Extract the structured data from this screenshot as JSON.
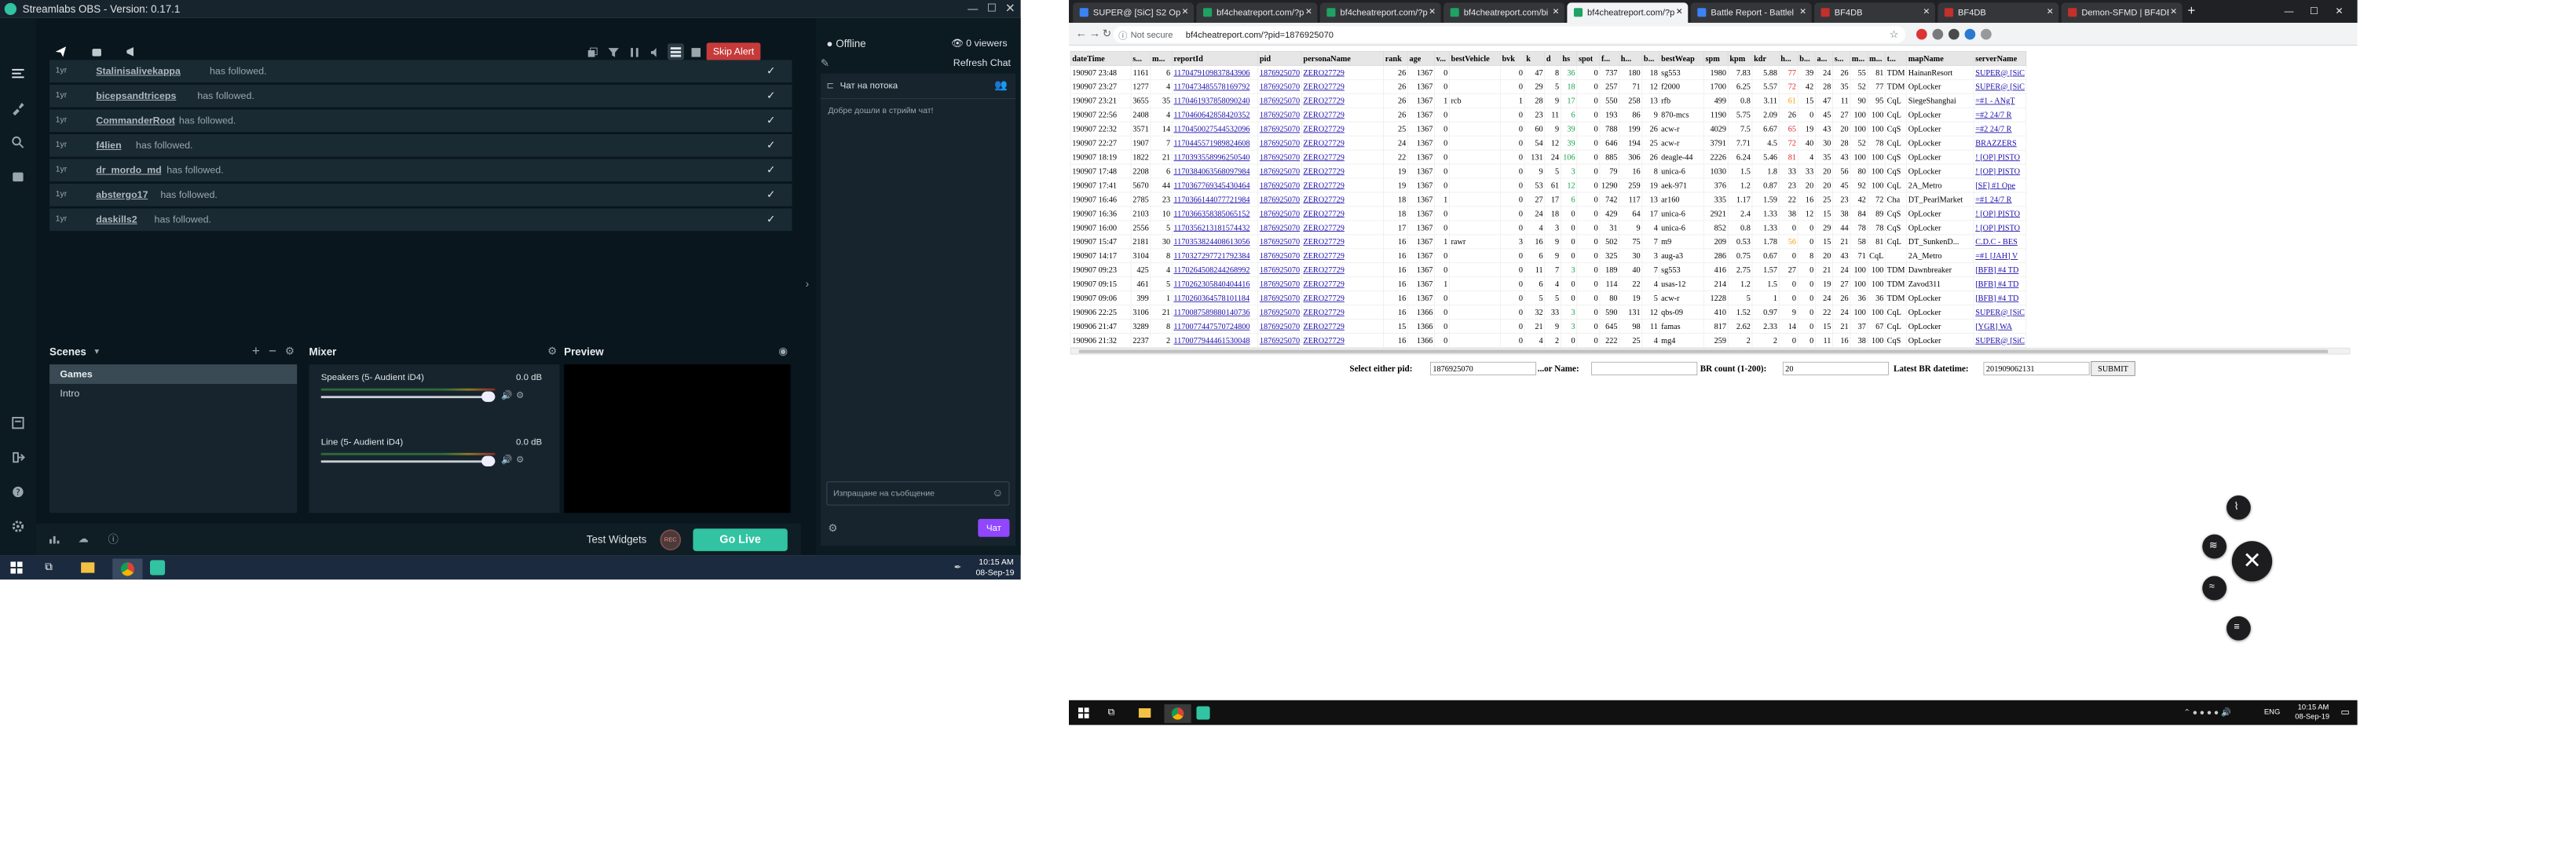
{
  "obs": {
    "title": "Streamlabs OBS - Version: 0.17.1",
    "skip_alert": "Skip Alert",
    "offline": "Offline",
    "viewers": "0 viewers",
    "refresh_chat": "Refresh Chat",
    "chat_title": "Чат на потока",
    "chat_welcome": "Добре дошли в стрийм чат!",
    "chat_placeholder": "Изпращане на съобщение",
    "chat_button": "Чат",
    "events": [
      {
        "time": "1yr",
        "name": "Stalinisalivekappa",
        "action": "has followed."
      },
      {
        "time": "1yr",
        "name": "bicepsandtriceps",
        "action": "has followed."
      },
      {
        "time": "1yr",
        "name": "CommanderRoot",
        "action": "has followed."
      },
      {
        "time": "1yr",
        "name": "f4lien",
        "action": "has followed."
      },
      {
        "time": "1yr",
        "name": "dr_mordo_md",
        "action": "has followed."
      },
      {
        "time": "1yr",
        "name": "abstergo17",
        "action": "has followed."
      },
      {
        "time": "1yr",
        "name": "daskills2",
        "action": "has followed."
      }
    ],
    "scenes_title": "Scenes",
    "scenes": [
      "Games",
      "Intro"
    ],
    "mixer_title": "Mixer",
    "mixer": [
      {
        "name": "Speakers (5- Audient iD4)",
        "db": "0.0 dB"
      },
      {
        "name": "Line (5- Audient iD4)",
        "db": "0.0 dB"
      }
    ],
    "preview_title": "Preview",
    "test_widgets": "Test Widgets",
    "rec": "REC",
    "go_live": "Go Live",
    "taskbar_time": "10:15 AM",
    "taskbar_date": "08-Sep-19"
  },
  "browser": {
    "tabs": [
      {
        "label": "SUPER@ [SiC] S2 Ope"
      },
      {
        "label": "bf4cheatreport.com/?p"
      },
      {
        "label": "bf4cheatreport.com/?p"
      },
      {
        "label": "bf4cheatreport.com/bi"
      },
      {
        "label": "bf4cheatreport.com/?p"
      },
      {
        "label": "Battle Report - Battlel"
      },
      {
        "label": "BF4DB"
      },
      {
        "label": "BF4DB"
      },
      {
        "label": "Demon-SFMD | BF4DB"
      }
    ],
    "not_secure": "Not secure",
    "url": "bf4cheatreport.com/?pid=1876925070",
    "columns": [
      "dateTime",
      "s...",
      "m...",
      "reportId",
      "pid",
      "personaName",
      "rank",
      "age",
      "v...",
      "bestVehicle",
      "bvk",
      "k",
      "d",
      "hs",
      "spot",
      "f...",
      "h...",
      "b...",
      "bestWeap",
      "spm",
      "kpm",
      "kdr",
      "h...",
      "b...",
      "a...",
      "s...",
      "m...",
      "m...",
      "t...",
      "mapName",
      "serverName"
    ],
    "rows": [
      [
        "190907 23:48",
        "1161",
        "6",
        "1170479109837843906",
        "1876925070",
        "ZERO27729",
        "26",
        "1367",
        "0",
        "",
        "0",
        "47",
        "8",
        "36",
        "0",
        "737",
        "180",
        "18",
        "sg553",
        "1980",
        "7.83",
        "5.88",
        "77",
        "39",
        "24",
        "26",
        "55",
        "81",
        "TDM",
        "HainanResort",
        "SUPER@ [SiC"
      ],
      [
        "190907 23:27",
        "1277",
        "4",
        "1170473485578169792",
        "1876925070",
        "ZERO27729",
        "26",
        "1367",
        "0",
        "",
        "0",
        "29",
        "5",
        "18",
        "0",
        "257",
        "71",
        "12",
        "f2000",
        "1700",
        "6.25",
        "5.57",
        "72",
        "42",
        "28",
        "35",
        "52",
        "77",
        "TDM",
        "OpLocker",
        "SUPER@ [SiC"
      ],
      [
        "190907 23:21",
        "3655",
        "35",
        "1170461937858090240",
        "1876925070",
        "ZERO27729",
        "26",
        "1367",
        "1",
        "rcb",
        "1",
        "28",
        "9",
        "17",
        "0",
        "550",
        "258",
        "13",
        "rfb",
        "499",
        "0.8",
        "3.11",
        "61",
        "15",
        "47",
        "11",
        "90",
        "95",
        "CqL",
        "SiegeShanghai",
        "=#1 - ANgT"
      ],
      [
        "190907 22:56",
        "2408",
        "4",
        "1170460642858420352",
        "1876925070",
        "ZERO27729",
        "26",
        "1367",
        "0",
        "",
        "0",
        "23",
        "11",
        "6",
        "0",
        "193",
        "86",
        "9",
        "870-mcs",
        "1190",
        "5.75",
        "2.09",
        "26",
        "0",
        "45",
        "27",
        "100",
        "100",
        "CqL",
        "OpLocker",
        "=#2  24/7 R"
      ],
      [
        "190907 22:32",
        "3571",
        "14",
        "1170450027544532096",
        "1876925070",
        "ZERO27729",
        "25",
        "1367",
        "0",
        "",
        "0",
        "60",
        "9",
        "39",
        "0",
        "788",
        "199",
        "26",
        "acw-r",
        "4029",
        "7.5",
        "6.67",
        "65",
        "19",
        "43",
        "20",
        "100",
        "100",
        "CqS",
        "OpLocker",
        "=#2  24/7 R"
      ],
      [
        "190907 22:27",
        "1907",
        "7",
        "1170445571989824608",
        "1876925070",
        "ZERO27729",
        "24",
        "1367",
        "0",
        "",
        "0",
        "54",
        "12",
        "39",
        "0",
        "646",
        "194",
        "25",
        "acw-r",
        "3791",
        "7.71",
        "4.5",
        "72",
        "40",
        "30",
        "28",
        "52",
        "78",
        "CqL",
        "OpLocker",
        "BRAZZERS"
      ],
      [
        "190907 18:19",
        "1822",
        "21",
        "1170393558996250540",
        "1876925070",
        "ZERO27729",
        "22",
        "1367",
        "0",
        "",
        "0",
        "131",
        "24",
        "106",
        "0",
        "885",
        "306",
        "26",
        "deagle-44",
        "2226",
        "6.24",
        "5.46",
        "81",
        "4",
        "35",
        "43",
        "100",
        "100",
        "CqS",
        "OpLocker",
        "! [OP] PISTO"
      ],
      [
        "190907 17:48",
        "2208",
        "6",
        "1170384063568097984",
        "1876925070",
        "ZERO27729",
        "19",
        "1367",
        "0",
        "",
        "0",
        "9",
        "5",
        "3",
        "0",
        "79",
        "16",
        "8",
        "unica-6",
        "1030",
        "1.5",
        "1.8",
        "33",
        "33",
        "20",
        "56",
        "80",
        "100",
        "CqS",
        "OpLocker",
        "! [OP] PISTO"
      ],
      [
        "190907 17:41",
        "5670",
        "44",
        "1170367769345430464",
        "1876925070",
        "ZERO27729",
        "19",
        "1367",
        "0",
        "",
        "0",
        "53",
        "61",
        "12",
        "0",
        "1290",
        "259",
        "19",
        "aek-971",
        "376",
        "1.2",
        "0.87",
        "23",
        "20",
        "20",
        "45",
        "92",
        "100",
        "CqL",
        "2A_Metro",
        "[SF]  #1 Ope"
      ],
      [
        "190907 16:46",
        "2785",
        "23",
        "1170366144077721984",
        "1876925070",
        "ZERO27729",
        "18",
        "1367",
        "1",
        "",
        "0",
        "27",
        "17",
        "6",
        "0",
        "742",
        "117",
        "13",
        "ar160",
        "335",
        "1.17",
        "1.59",
        "22",
        "16",
        "25",
        "23",
        "42",
        "72",
        "Cha",
        "DT_PearlMarket",
        "=#1  24/7 R"
      ],
      [
        "190907 16:36",
        "2103",
        "10",
        "1170366358385065152",
        "1876925070",
        "ZERO27729",
        "18",
        "1367",
        "0",
        "",
        "0",
        "24",
        "18",
        "0",
        "0",
        "429",
        "64",
        "17",
        "unica-6",
        "2921",
        "2.4",
        "1.33",
        "38",
        "12",
        "15",
        "38",
        "84",
        "89",
        "CqS",
        "OpLocker",
        "! [OP] PISTO"
      ],
      [
        "190907 16:00",
        "2556",
        "5",
        "1170356213181574432",
        "1876925070",
        "ZERO27729",
        "17",
        "1367",
        "0",
        "",
        "0",
        "4",
        "3",
        "0",
        "0",
        "31",
        "9",
        "4",
        "unica-6",
        "852",
        "0.8",
        "1.33",
        "0",
        "0",
        "29",
        "44",
        "78",
        "78",
        "CqS",
        "OpLocker",
        "! [OP] PISTO"
      ],
      [
        "190907 15:47",
        "2181",
        "30",
        "1170353824408613056",
        "1876925070",
        "ZERO27729",
        "16",
        "1367",
        "1",
        "rawr",
        "3",
        "16",
        "9",
        "0",
        "0",
        "502",
        "75",
        "7",
        "m9",
        "209",
        "0.53",
        "1.78",
        "56",
        "0",
        "15",
        "21",
        "58",
        "81",
        "CqL",
        "DT_SunkenD...",
        "C.D.C - BES"
      ],
      [
        "190907 14:17",
        "3104",
        "8",
        "1170327297721792384",
        "1876925070",
        "ZERO27729",
        "16",
        "1367",
        "0",
        "",
        "0",
        "6",
        "9",
        "0",
        "0",
        "325",
        "30",
        "3",
        "aug-a3",
        "286",
        "0.75",
        "0.67",
        "0",
        "8",
        "20",
        "43",
        "71",
        "CqL",
        "",
        "2A_Metro",
        "=#1 [JAH] V"
      ],
      [
        "190907 09:23",
        "425",
        "4",
        "1170264508244268992",
        "1876925070",
        "ZERO27729",
        "16",
        "1367",
        "0",
        "",
        "0",
        "11",
        "7",
        "3",
        "0",
        "189",
        "40",
        "7",
        "sg553",
        "416",
        "2.75",
        "1.57",
        "27",
        "0",
        "21",
        "24",
        "100",
        "100",
        "TDM",
        "Dawnbreaker",
        "[BFB] #4 TD"
      ],
      [
        "190907 09:15",
        "461",
        "5",
        "1170262305840404416",
        "1876925070",
        "ZERO27729",
        "16",
        "1367",
        "1",
        "",
        "0",
        "6",
        "4",
        "0",
        "0",
        "114",
        "22",
        "4",
        "usas-12",
        "214",
        "1.2",
        "1.5",
        "0",
        "0",
        "19",
        "27",
        "100",
        "100",
        "TDM",
        "Zavod311",
        "[BFB] #4 TD"
      ],
      [
        "190907 09:06",
        "399",
        "1",
        "1170260364578101184",
        "1876925070",
        "ZERO27729",
        "16",
        "1367",
        "0",
        "",
        "0",
        "5",
        "5",
        "0",
        "0",
        "80",
        "19",
        "5",
        "acw-r",
        "1228",
        "5",
        "1",
        "0",
        "0",
        "24",
        "26",
        "36",
        "36",
        "TDM",
        "OpLocker",
        "[BFB] #4 TD"
      ],
      [
        "190906 22:25",
        "3106",
        "21",
        "1170087589880140736",
        "1876925070",
        "ZERO27729",
        "16",
        "1366",
        "0",
        "",
        "0",
        "32",
        "33",
        "3",
        "0",
        "590",
        "131",
        "12",
        "qbs-09",
        "410",
        "1.52",
        "0.97",
        "9",
        "0",
        "22",
        "24",
        "100",
        "100",
        "CqL",
        "OpLocker",
        "SUPER@ [SiC"
      ],
      [
        "190906 21:47",
        "3289",
        "8",
        "1170077447570724800",
        "1876925070",
        "ZERO27729",
        "15",
        "1366",
        "0",
        "",
        "0",
        "21",
        "9",
        "3",
        "0",
        "645",
        "98",
        "11",
        "famas",
        "817",
        "2.62",
        "2.33",
        "14",
        "0",
        "15",
        "21",
        "37",
        "67",
        "CqL",
        "OpLocker",
        "[YGR] WA"
      ],
      [
        "190906 21:32",
        "2237",
        "2",
        "1170077944461530048",
        "1876925070",
        "ZERO27729",
        "16",
        "1366",
        "0",
        "",
        "0",
        "4",
        "2",
        "0",
        "0",
        "222",
        "25",
        "4",
        "mg4",
        "259",
        "2",
        "2",
        "0",
        "0",
        "11",
        "16",
        "38",
        "100",
        "CqS",
        "OpLocker",
        "SUPER@ [SiC"
      ]
    ],
    "form": {
      "pid_label": "Select either pid:",
      "pid_value": "1876925070",
      "name_label": "...or Name:",
      "name_value": "",
      "count_label": "BR count (1-200):",
      "count_value": "20",
      "latest_label": "Latest BR datetime:",
      "latest_value": "201909062131",
      "submit": "SUBMIT"
    },
    "taskbar_lang": "ENG",
    "taskbar_time": "10:15 AM",
    "taskbar_date": "08-Sep-19"
  }
}
